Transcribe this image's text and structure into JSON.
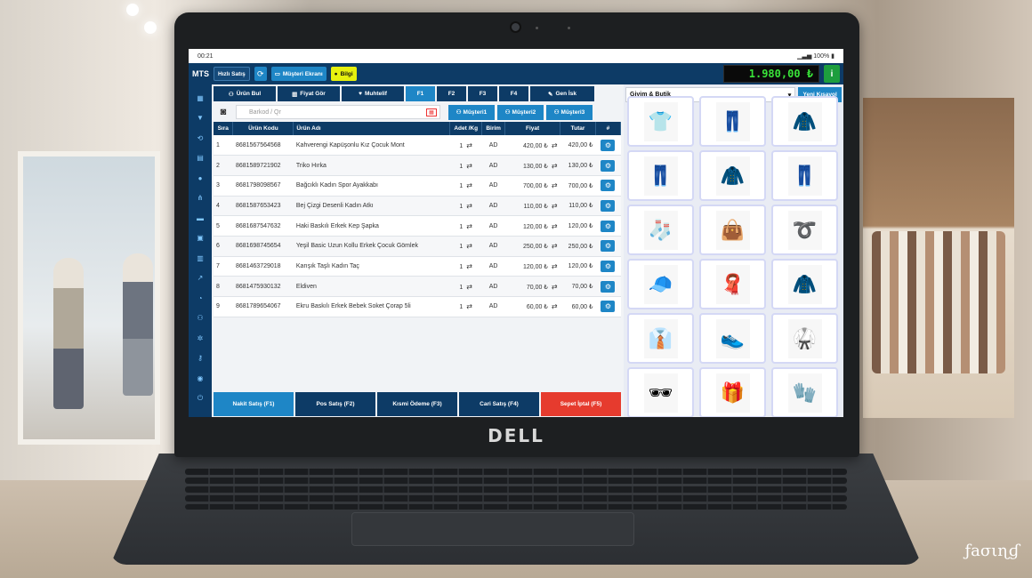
{
  "status": {
    "time": "00:21",
    "battery": "100%"
  },
  "app": {
    "logo": "MTS",
    "quick_sale": "Hızlı Satış",
    "customer_screen": "Müşteri Ekranı",
    "info": "Bilgi",
    "total": "1.980,00 ₺"
  },
  "toolbar": {
    "find_product": "Ürün Bul",
    "price_check": "Fiyat Gör",
    "misc": "Muhtelif",
    "f1": "F1",
    "f2": "F2",
    "f3": "F3",
    "f4": "F4",
    "gen_isk": "Gen İsk"
  },
  "search": {
    "barcode_placeholder": "Barkod / Qr",
    "customer1": "Müşteri1",
    "customer2": "Müşteri2",
    "customer3": "Müşteri3"
  },
  "table": {
    "headers": [
      "Sıra",
      "Ürün Kodu",
      "Ürün Adı",
      "Adet /Kg",
      "Birim",
      "Fiyat",
      "Tutar",
      "#"
    ],
    "rows": [
      {
        "no": "1",
        "code": "8681567564568",
        "name": "Kahverengi Kapüşonlu Kız Çocuk Mont",
        "qty": "1",
        "unit": "AD",
        "price": "420,00 ₺",
        "total": "420,00 ₺"
      },
      {
        "no": "2",
        "code": "8681589721902",
        "name": "Triko Hırka",
        "qty": "1",
        "unit": "AD",
        "price": "130,00 ₺",
        "total": "130,00 ₺"
      },
      {
        "no": "3",
        "code": "8681798098567",
        "name": "Bağcıklı Kadın Spor Ayakkabı",
        "qty": "1",
        "unit": "AD",
        "price": "700,00 ₺",
        "total": "700,00 ₺"
      },
      {
        "no": "4",
        "code": "8681587653423",
        "name": "Bej Çizgi Desenli Kadın Atkı",
        "qty": "1",
        "unit": "AD",
        "price": "110,00 ₺",
        "total": "110,00 ₺"
      },
      {
        "no": "5",
        "code": "8681687547632",
        "name": "Haki Baskılı Erkek Kep Şapka",
        "qty": "1",
        "unit": "AD",
        "price": "120,00 ₺",
        "total": "120,00 ₺"
      },
      {
        "no": "6",
        "code": "8681698745654",
        "name": "Yeşil Basic Uzun Kollu Erkek Çocuk Gömlek",
        "qty": "1",
        "unit": "AD",
        "price": "250,00 ₺",
        "total": "250,00 ₺"
      },
      {
        "no": "7",
        "code": "8681463729018",
        "name": "Karışık Taşlı Kadın Taç",
        "qty": "1",
        "unit": "AD",
        "price": "120,00 ₺",
        "total": "120,00 ₺"
      },
      {
        "no": "8",
        "code": "8681475930132",
        "name": "Eldiven",
        "qty": "1",
        "unit": "AD",
        "price": "70,00 ₺",
        "total": "70,00 ₺"
      },
      {
        "no": "9",
        "code": "8681789654067",
        "name": "Ekru Baskılı Erkek Bebek Soket Çorap 5li",
        "qty": "1",
        "unit": "AD",
        "price": "60,00 ₺",
        "total": "60,00 ₺"
      }
    ]
  },
  "payments": {
    "cash": "Nakit Satış (F1)",
    "pos": "Pos Satış (F2)",
    "partial": "Kısmi Ödeme (F3)",
    "account": "Cari Satış (F4)",
    "cancel": "Sepet İptal (F5)"
  },
  "catalog": {
    "category": "Giyim & Butik",
    "new_shortcut": "Yeni Kısayol"
  },
  "laptop": {
    "brand": "DELL"
  },
  "corner": "ƒaσιɳɠ",
  "colors": {
    "navy": "#0d3b66",
    "accent": "#1e86c6",
    "total_text": "#39e339",
    "cancel": "#e63b2e",
    "info": "#e6f00e"
  }
}
